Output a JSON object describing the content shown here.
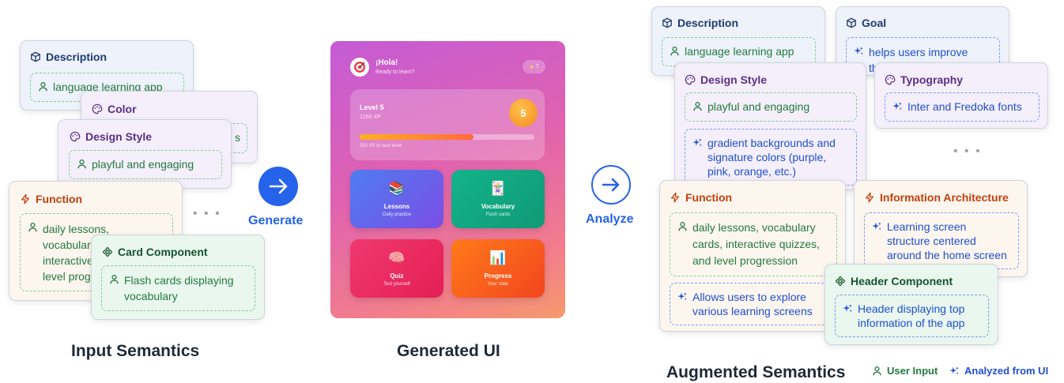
{
  "input": {
    "label": "Input Semantics",
    "description": {
      "title": "Description",
      "value": "language learning app"
    },
    "color": {
      "title": "Color",
      "visible_tail": "s"
    },
    "design_style": {
      "title": "Design Style",
      "value": "playful and engaging"
    },
    "function": {
      "title": "Function",
      "lines": [
        "daily lessons,",
        "vocabular",
        "interactive",
        "level progr"
      ]
    },
    "card_component": {
      "title": "Card Component",
      "lines": [
        "Flash cards displaying",
        "vocabulary"
      ]
    },
    "more": "• • •"
  },
  "generate": {
    "label": "Generate"
  },
  "generated_ui": {
    "label": "Generated UI",
    "greeting": "¡Hola!",
    "subtitle": "Ready to learn?",
    "streak": "7",
    "level": {
      "title": "Level 5",
      "xp": "1250 XP",
      "badge": "5",
      "next": "250 XP to next level",
      "progress": 0.65
    },
    "tiles": [
      {
        "icon": "📚",
        "title": "Lessons",
        "subtitle": "Daily practice",
        "color_from": "#4f7cf0",
        "color_to": "#7b4ee6"
      },
      {
        "icon": "🃏",
        "title": "Vocabulary",
        "subtitle": "Flash cards",
        "color_from": "#14b38a",
        "color_to": "#0f9a76"
      },
      {
        "icon": "🧠",
        "title": "Quiz",
        "subtitle": "Test yourself",
        "color_from": "#f0386d",
        "color_to": "#e31f55"
      },
      {
        "icon": "📊",
        "title": "Progress",
        "subtitle": "Your stats",
        "color_from": "#ff7a1a",
        "color_to": "#f2461f"
      }
    ]
  },
  "analyze": {
    "label": "Analyze"
  },
  "augmented": {
    "label": "Augmented Semantics",
    "description": {
      "title": "Description",
      "value": "language learning app"
    },
    "goal": {
      "title": "Goal",
      "lines": [
        "helps users improve",
        "thei"
      ]
    },
    "design_style": {
      "title": "Design Style",
      "user": "playful and engaging",
      "analyzed": [
        "gradient backgrounds and",
        "signature colors (purple,",
        "pink, orange, etc.)"
      ]
    },
    "typography": {
      "title": "Typography",
      "value": "Inter and Fredoka fonts"
    },
    "more": "• • •",
    "function": {
      "title": "Function",
      "user": [
        "daily lessons, vocabulary",
        "cards, interactive quizzes,",
        "and level progression"
      ],
      "analyzed": [
        "Allows users to explore",
        "various learning screens"
      ]
    },
    "info_arch": {
      "title": "Information Architecture",
      "lines": [
        "Learning screen",
        "structure centered",
        "around the home screen"
      ]
    },
    "header_component": {
      "title": "Header Component",
      "lines": [
        "Header displaying top",
        "information of the app"
      ]
    }
  },
  "legend": {
    "user_input": "User Input",
    "analyzed": "Analyzed from UI"
  },
  "colors": {
    "user": "#237a3e",
    "analyzed": "#1f4fcf",
    "accent": "#2563eb"
  }
}
